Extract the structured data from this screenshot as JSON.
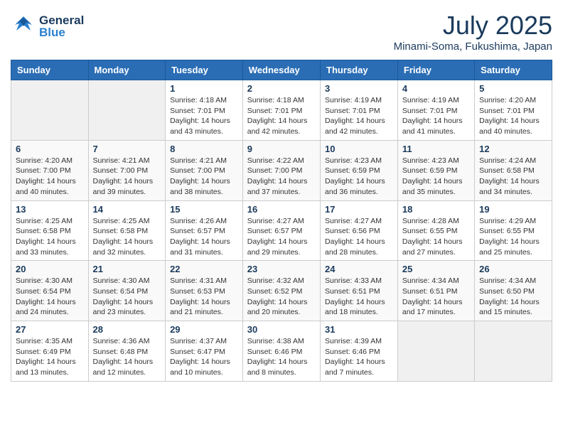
{
  "header": {
    "logo_general": "General",
    "logo_blue": "Blue",
    "month_title": "July 2025",
    "location": "Minami-Soma, Fukushima, Japan"
  },
  "weekdays": [
    "Sunday",
    "Monday",
    "Tuesday",
    "Wednesday",
    "Thursday",
    "Friday",
    "Saturday"
  ],
  "weeks": [
    [
      {
        "day": "",
        "sunrise": "",
        "sunset": "",
        "daylight": ""
      },
      {
        "day": "",
        "sunrise": "",
        "sunset": "",
        "daylight": ""
      },
      {
        "day": "1",
        "sunrise": "Sunrise: 4:18 AM",
        "sunset": "Sunset: 7:01 PM",
        "daylight": "Daylight: 14 hours and 43 minutes."
      },
      {
        "day": "2",
        "sunrise": "Sunrise: 4:18 AM",
        "sunset": "Sunset: 7:01 PM",
        "daylight": "Daylight: 14 hours and 42 minutes."
      },
      {
        "day": "3",
        "sunrise": "Sunrise: 4:19 AM",
        "sunset": "Sunset: 7:01 PM",
        "daylight": "Daylight: 14 hours and 42 minutes."
      },
      {
        "day": "4",
        "sunrise": "Sunrise: 4:19 AM",
        "sunset": "Sunset: 7:01 PM",
        "daylight": "Daylight: 14 hours and 41 minutes."
      },
      {
        "day": "5",
        "sunrise": "Sunrise: 4:20 AM",
        "sunset": "Sunset: 7:01 PM",
        "daylight": "Daylight: 14 hours and 40 minutes."
      }
    ],
    [
      {
        "day": "6",
        "sunrise": "Sunrise: 4:20 AM",
        "sunset": "Sunset: 7:00 PM",
        "daylight": "Daylight: 14 hours and 40 minutes."
      },
      {
        "day": "7",
        "sunrise": "Sunrise: 4:21 AM",
        "sunset": "Sunset: 7:00 PM",
        "daylight": "Daylight: 14 hours and 39 minutes."
      },
      {
        "day": "8",
        "sunrise": "Sunrise: 4:21 AM",
        "sunset": "Sunset: 7:00 PM",
        "daylight": "Daylight: 14 hours and 38 minutes."
      },
      {
        "day": "9",
        "sunrise": "Sunrise: 4:22 AM",
        "sunset": "Sunset: 7:00 PM",
        "daylight": "Daylight: 14 hours and 37 minutes."
      },
      {
        "day": "10",
        "sunrise": "Sunrise: 4:23 AM",
        "sunset": "Sunset: 6:59 PM",
        "daylight": "Daylight: 14 hours and 36 minutes."
      },
      {
        "day": "11",
        "sunrise": "Sunrise: 4:23 AM",
        "sunset": "Sunset: 6:59 PM",
        "daylight": "Daylight: 14 hours and 35 minutes."
      },
      {
        "day": "12",
        "sunrise": "Sunrise: 4:24 AM",
        "sunset": "Sunset: 6:58 PM",
        "daylight": "Daylight: 14 hours and 34 minutes."
      }
    ],
    [
      {
        "day": "13",
        "sunrise": "Sunrise: 4:25 AM",
        "sunset": "Sunset: 6:58 PM",
        "daylight": "Daylight: 14 hours and 33 minutes."
      },
      {
        "day": "14",
        "sunrise": "Sunrise: 4:25 AM",
        "sunset": "Sunset: 6:58 PM",
        "daylight": "Daylight: 14 hours and 32 minutes."
      },
      {
        "day": "15",
        "sunrise": "Sunrise: 4:26 AM",
        "sunset": "Sunset: 6:57 PM",
        "daylight": "Daylight: 14 hours and 31 minutes."
      },
      {
        "day": "16",
        "sunrise": "Sunrise: 4:27 AM",
        "sunset": "Sunset: 6:57 PM",
        "daylight": "Daylight: 14 hours and 29 minutes."
      },
      {
        "day": "17",
        "sunrise": "Sunrise: 4:27 AM",
        "sunset": "Sunset: 6:56 PM",
        "daylight": "Daylight: 14 hours and 28 minutes."
      },
      {
        "day": "18",
        "sunrise": "Sunrise: 4:28 AM",
        "sunset": "Sunset: 6:55 PM",
        "daylight": "Daylight: 14 hours and 27 minutes."
      },
      {
        "day": "19",
        "sunrise": "Sunrise: 4:29 AM",
        "sunset": "Sunset: 6:55 PM",
        "daylight": "Daylight: 14 hours and 25 minutes."
      }
    ],
    [
      {
        "day": "20",
        "sunrise": "Sunrise: 4:30 AM",
        "sunset": "Sunset: 6:54 PM",
        "daylight": "Daylight: 14 hours and 24 minutes."
      },
      {
        "day": "21",
        "sunrise": "Sunrise: 4:30 AM",
        "sunset": "Sunset: 6:54 PM",
        "daylight": "Daylight: 14 hours and 23 minutes."
      },
      {
        "day": "22",
        "sunrise": "Sunrise: 4:31 AM",
        "sunset": "Sunset: 6:53 PM",
        "daylight": "Daylight: 14 hours and 21 minutes."
      },
      {
        "day": "23",
        "sunrise": "Sunrise: 4:32 AM",
        "sunset": "Sunset: 6:52 PM",
        "daylight": "Daylight: 14 hours and 20 minutes."
      },
      {
        "day": "24",
        "sunrise": "Sunrise: 4:33 AM",
        "sunset": "Sunset: 6:51 PM",
        "daylight": "Daylight: 14 hours and 18 minutes."
      },
      {
        "day": "25",
        "sunrise": "Sunrise: 4:34 AM",
        "sunset": "Sunset: 6:51 PM",
        "daylight": "Daylight: 14 hours and 17 minutes."
      },
      {
        "day": "26",
        "sunrise": "Sunrise: 4:34 AM",
        "sunset": "Sunset: 6:50 PM",
        "daylight": "Daylight: 14 hours and 15 minutes."
      }
    ],
    [
      {
        "day": "27",
        "sunrise": "Sunrise: 4:35 AM",
        "sunset": "Sunset: 6:49 PM",
        "daylight": "Daylight: 14 hours and 13 minutes."
      },
      {
        "day": "28",
        "sunrise": "Sunrise: 4:36 AM",
        "sunset": "Sunset: 6:48 PM",
        "daylight": "Daylight: 14 hours and 12 minutes."
      },
      {
        "day": "29",
        "sunrise": "Sunrise: 4:37 AM",
        "sunset": "Sunset: 6:47 PM",
        "daylight": "Daylight: 14 hours and 10 minutes."
      },
      {
        "day": "30",
        "sunrise": "Sunrise: 4:38 AM",
        "sunset": "Sunset: 6:46 PM",
        "daylight": "Daylight: 14 hours and 8 minutes."
      },
      {
        "day": "31",
        "sunrise": "Sunrise: 4:39 AM",
        "sunset": "Sunset: 6:46 PM",
        "daylight": "Daylight: 14 hours and 7 minutes."
      },
      {
        "day": "",
        "sunrise": "",
        "sunset": "",
        "daylight": ""
      },
      {
        "day": "",
        "sunrise": "",
        "sunset": "",
        "daylight": ""
      }
    ]
  ]
}
